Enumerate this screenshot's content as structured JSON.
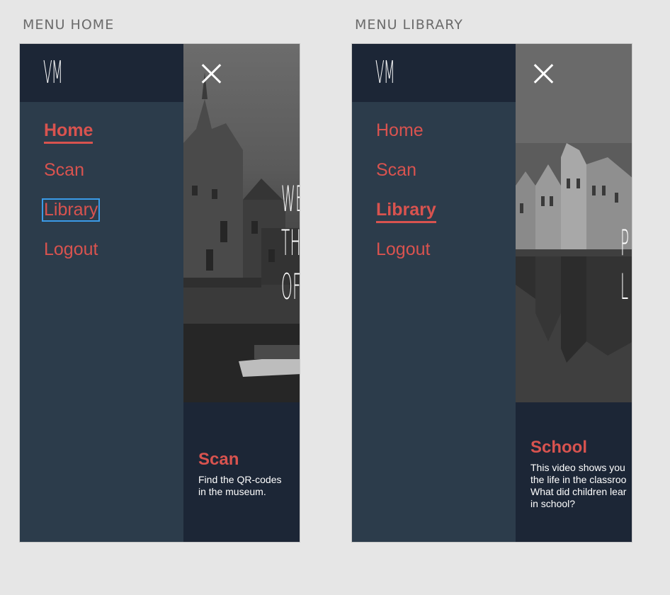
{
  "artboards": [
    {
      "title": "MENU HOME",
      "logo": "VM",
      "nav": [
        "Home",
        "Scan",
        "Library",
        "Logout"
      ],
      "active": "Home",
      "focused": "Library",
      "hero_text": "WE\nTH\nOF",
      "card": {
        "title": "Scan",
        "description": "Find the QR-codes\nin the museum."
      }
    },
    {
      "title": "MENU LIBRARY",
      "logo": "VM",
      "nav": [
        "Home",
        "Scan",
        "Library",
        "Logout"
      ],
      "active": "Library",
      "hero_text": "P\nL",
      "card": {
        "title": "School",
        "description": "This video shows you\nthe life in the classroo\nWhat did children lear\nin school?"
      }
    }
  ],
  "colors": {
    "accent": "#d9534f",
    "sidebar": "#2c3c4b",
    "header": "#1c2636",
    "background": "#e6e6e6",
    "focus": "#3a9be8"
  },
  "icons": {
    "close": "close-icon"
  }
}
